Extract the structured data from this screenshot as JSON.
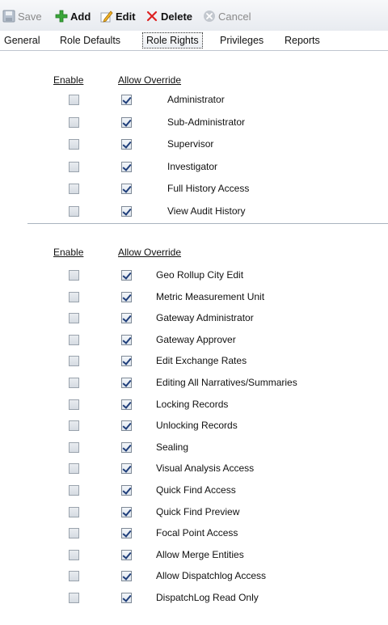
{
  "toolbar": {
    "save_label": "Save",
    "add_label": "Add",
    "edit_label": "Edit",
    "delete_label": "Delete",
    "cancel_label": "Cancel"
  },
  "tabs": [
    {
      "label": "General"
    },
    {
      "label": "Role Defaults"
    },
    {
      "label": "Role Rights",
      "active": true
    },
    {
      "label": "Privileges"
    },
    {
      "label": "Reports"
    }
  ],
  "section1": {
    "enable_header": "Enable",
    "override_header": "Allow Override",
    "items": [
      {
        "label": "Administrator",
        "enable": false,
        "override": true
      },
      {
        "label": "Sub-Administrator",
        "enable": false,
        "override": true
      },
      {
        "label": "Supervisor",
        "enable": false,
        "override": true
      },
      {
        "label": "Investigator",
        "enable": false,
        "override": true
      },
      {
        "label": "Full History Access",
        "enable": false,
        "override": true
      },
      {
        "label": "View Audit History",
        "enable": false,
        "override": true
      }
    ]
  },
  "section2": {
    "enable_header": "Enable",
    "override_header": "Allow Override",
    "items": [
      {
        "label": "Geo Rollup City Edit",
        "enable": false,
        "override": true
      },
      {
        "label": "Metric Measurement Unit",
        "enable": false,
        "override": true
      },
      {
        "label": "Gateway Administrator",
        "enable": false,
        "override": true
      },
      {
        "label": "Gateway Approver",
        "enable": false,
        "override": true
      },
      {
        "label": "Edit Exchange Rates",
        "enable": false,
        "override": true
      },
      {
        "label": "Editing All Narratives/Summaries",
        "enable": false,
        "override": true
      },
      {
        "label": "Locking Records",
        "enable": false,
        "override": true
      },
      {
        "label": "Unlocking Records",
        "enable": false,
        "override": true
      },
      {
        "label": "Sealing",
        "enable": false,
        "override": true
      },
      {
        "label": "Visual Analysis Access",
        "enable": false,
        "override": true
      },
      {
        "label": "Quick Find Access",
        "enable": false,
        "override": true
      },
      {
        "label": "Quick Find Preview",
        "enable": false,
        "override": true
      },
      {
        "label": "Focal Point Access",
        "enable": false,
        "override": true
      },
      {
        "label": "Allow Merge Entities",
        "enable": false,
        "override": true
      },
      {
        "label": "Allow Dispatchlog Access",
        "enable": false,
        "override": true
      },
      {
        "label": "DispatchLog Read Only",
        "enable": false,
        "override": true
      }
    ]
  }
}
